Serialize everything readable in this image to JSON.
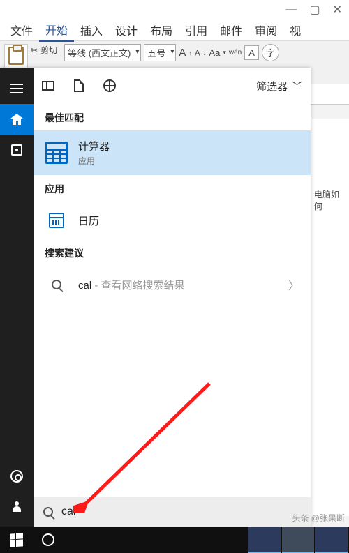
{
  "word": {
    "window": {
      "min": "—",
      "max": "▢",
      "close": "✕"
    },
    "menu": [
      "文件",
      "开始",
      "插入",
      "设计",
      "布局",
      "引用",
      "邮件",
      "审阅",
      "视"
    ],
    "menu_active_index": 1,
    "ribbon": {
      "cut": "剪切",
      "font_name": "等线 (西文正文)",
      "font_size": "五号",
      "btn_A_up": "A",
      "btn_A_dn": "A",
      "btn_Aa": "Aa",
      "btn_wen": "wén",
      "btn_A3": "A",
      "btn_A_box": "A",
      "btn_circle": "字"
    },
    "doc_text": "电脑如何"
  },
  "start": {
    "tabs": {
      "filter_label": "筛选器"
    },
    "sections": {
      "best": "最佳匹配",
      "apps": "应用",
      "suggestions": "搜索建议"
    },
    "best_match": {
      "title": "计算器",
      "subtitle": "应用"
    },
    "apps": [
      {
        "title": "日历"
      }
    ],
    "suggestions": [
      {
        "prefix": "cal",
        "suffix": " - 查看网络搜索结果"
      }
    ],
    "search_value": "cal"
  },
  "watermark": "头条 @张果断"
}
